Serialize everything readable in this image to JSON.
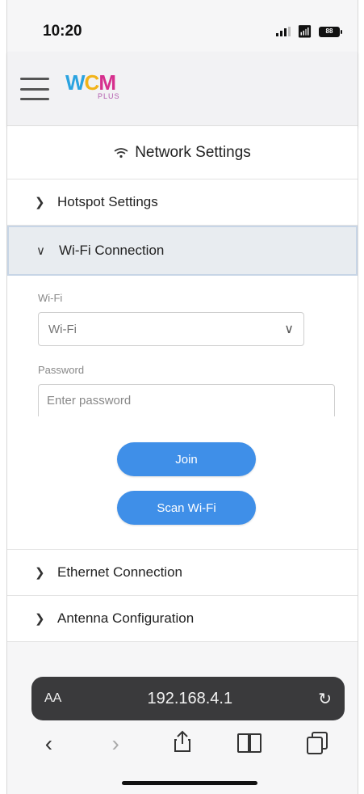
{
  "status_bar": {
    "time": "10:20",
    "battery": "88"
  },
  "header": {
    "logo_main": [
      "W",
      "C",
      "M"
    ],
    "logo_sub": "PLUS"
  },
  "page": {
    "title": "Network Settings",
    "title_icon": "wifi-icon"
  },
  "accordion": {
    "hotspot": "Hotspot Settings",
    "wifi": "Wi-Fi Connection",
    "ethernet": "Ethernet Connection",
    "antenna": "Antenna Configuration"
  },
  "wifi_form": {
    "wifi_label": "Wi-Fi",
    "wifi_selected": "Wi-Fi",
    "password_label": "Password",
    "password_placeholder": "Enter password",
    "join_label": "Join",
    "scan_label": "Scan Wi-Fi"
  },
  "browser": {
    "aa": "AA",
    "url": "192.168.4.1"
  },
  "colors": {
    "button": "#3f8fe8",
    "logo_w": "#2ba3e0",
    "logo_c": "#f2b318",
    "logo_m": "#d62f8d"
  }
}
